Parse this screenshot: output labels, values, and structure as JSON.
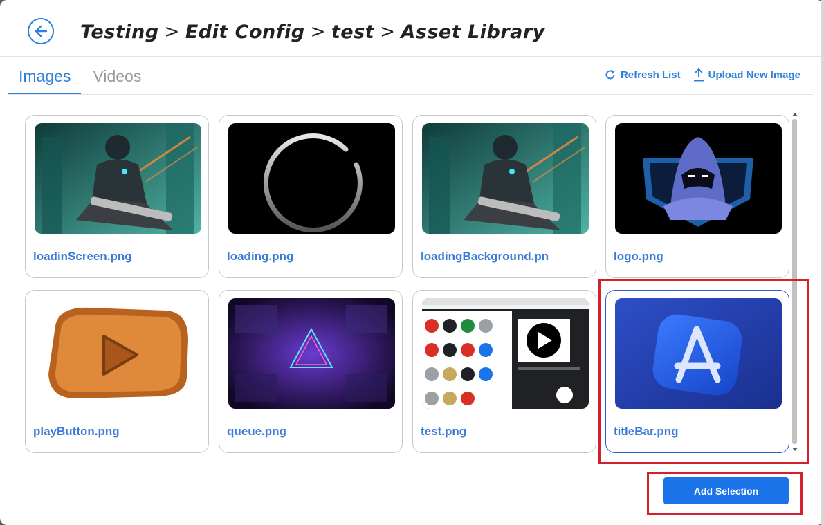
{
  "header": {
    "breadcrumb": [
      "Testing",
      "Edit Config",
      "test",
      "Asset Library"
    ],
    "separator": ">"
  },
  "tabs": [
    {
      "label": "Images",
      "active": true
    },
    {
      "label": "Videos",
      "active": false
    }
  ],
  "actions": {
    "refresh_label": "Refresh List",
    "upload_label": "Upload New Image"
  },
  "assets": [
    {
      "name": "loadinScreen.png",
      "thumb": "cyberpunk-soldier"
    },
    {
      "name": "loading.png",
      "thumb": "loading-ring"
    },
    {
      "name": "loadingBackground.pn",
      "thumb": "cyberpunk-soldier"
    },
    {
      "name": "logo.png",
      "thumb": "hooded-mascot"
    },
    {
      "name": "playButton.png",
      "thumb": "wooden-play-button"
    },
    {
      "name": "queue.png",
      "thumb": "neon-tunnel"
    },
    {
      "name": "test.png",
      "thumb": "browser-screenshot"
    },
    {
      "name": "titleBar.png",
      "thumb": "app-store-icon",
      "selected": true
    }
  ],
  "footer": {
    "add_label": "Add Selection"
  },
  "colors": {
    "accent": "#2f80d8",
    "button": "#1a73e8",
    "highlight": "#d3202a"
  }
}
